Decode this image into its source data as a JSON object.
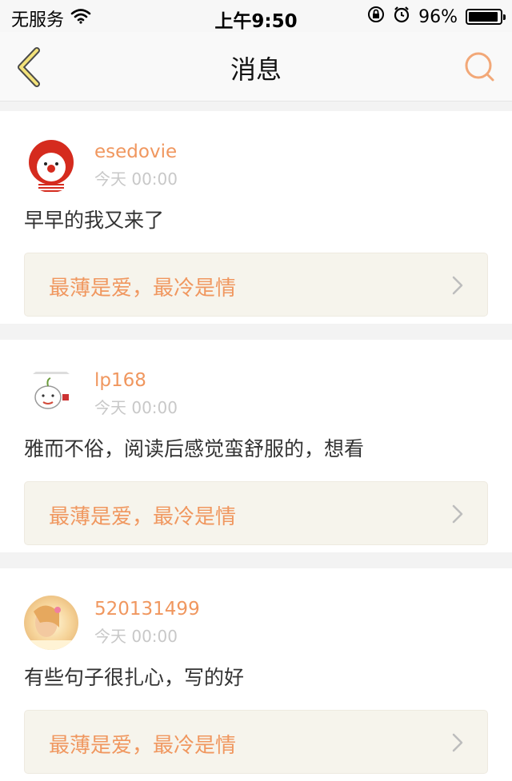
{
  "status_bar": {
    "carrier": "无服务",
    "time": "上午9:50",
    "battery": "96%",
    "battery_level": 0.96
  },
  "nav": {
    "title": "消息",
    "back_icon": "chevron-left-icon",
    "search_icon": "search-icon",
    "accent": "#f0975f"
  },
  "messages": [
    {
      "username": "esedovie",
      "time": "今天 00:00",
      "content": "早早的我又来了",
      "quote": "最薄是爱，最冷是情",
      "avatar": "clown-avatar"
    },
    {
      "username": "lp168",
      "time": "今天 00:00",
      "content": "雅而不俗，阅读后感觉蛮舒服的，想看",
      "quote": "最薄是爱，最冷是情",
      "avatar": "cartoon-avatar"
    },
    {
      "username": "520131499",
      "time": "今天 00:00",
      "content": "有些句子很扎心，写的好",
      "quote": "最薄是爱，最冷是情",
      "avatar": "girl-avatar"
    }
  ]
}
